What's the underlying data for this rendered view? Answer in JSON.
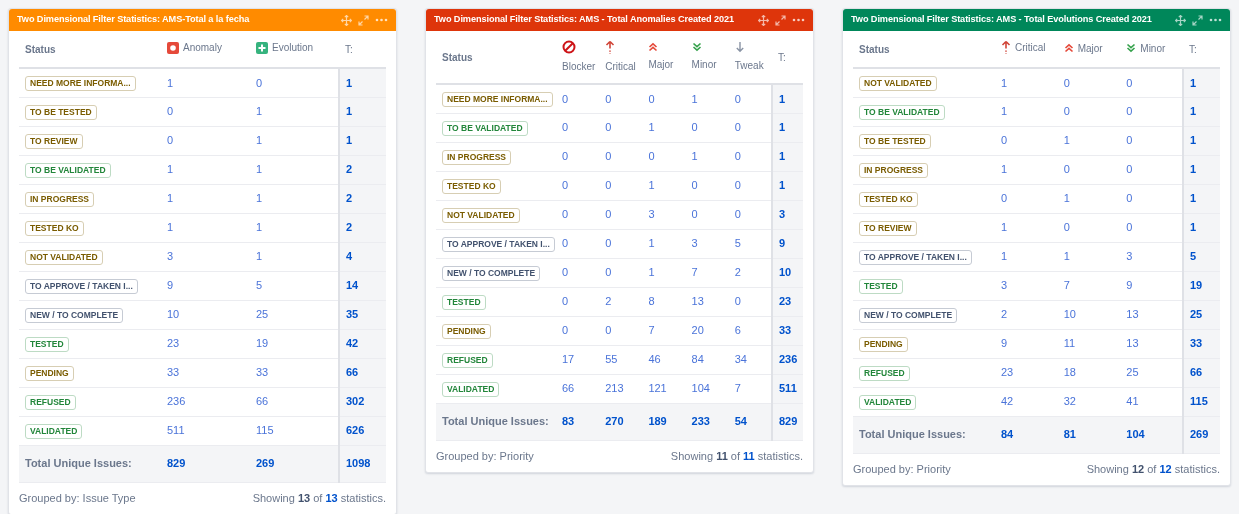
{
  "gadgets": [
    {
      "title": "Two Dimensional Filter Statistics: AMS-Total a la fecha",
      "color": "#ff8b00",
      "stacked": false,
      "status_label": "Status",
      "total_label": "T:",
      "columns": [
        {
          "label": "Anomaly",
          "kind": "anomaly"
        },
        {
          "label": "Evolution",
          "kind": "evolution"
        }
      ],
      "rows": [
        {
          "status": "NEED MORE INFORMA...",
          "color": "#7a5c00",
          "values": [
            "1",
            "0"
          ],
          "total": "1"
        },
        {
          "status": "TO BE TESTED",
          "color": "#7a5c00",
          "values": [
            "0",
            "1"
          ],
          "total": "1"
        },
        {
          "status": "TO REVIEW",
          "color": "#7a5c00",
          "values": [
            "0",
            "1"
          ],
          "total": "1"
        },
        {
          "status": "TO BE VALIDATED",
          "color": "#22863a",
          "values": [
            "1",
            "1"
          ],
          "total": "2"
        },
        {
          "status": "IN PROGRESS",
          "color": "#7a5c00",
          "values": [
            "1",
            "1"
          ],
          "total": "2"
        },
        {
          "status": "TESTED KO",
          "color": "#7a5c00",
          "values": [
            "1",
            "1"
          ],
          "total": "2"
        },
        {
          "status": "NOT VALIDATED",
          "color": "#7a5c00",
          "values": [
            "3",
            "1"
          ],
          "total": "4"
        },
        {
          "status": "TO APPROVE / TAKEN I...",
          "color": "#42526e",
          "values": [
            "9",
            "5"
          ],
          "total": "14"
        },
        {
          "status": "NEW / TO COMPLETE",
          "color": "#42526e",
          "values": [
            "10",
            "25"
          ],
          "total": "35"
        },
        {
          "status": "TESTED",
          "color": "#22863a",
          "values": [
            "23",
            "19"
          ],
          "total": "42"
        },
        {
          "status": "PENDING",
          "color": "#7a5c00",
          "values": [
            "33",
            "33"
          ],
          "total": "66"
        },
        {
          "status": "REFUSED",
          "color": "#22863a",
          "values": [
            "236",
            "66"
          ],
          "total": "302"
        },
        {
          "status": "VALIDATED",
          "color": "#22863a",
          "values": [
            "511",
            "115"
          ],
          "total": "626"
        }
      ],
      "totals": {
        "label": "Total Unique Issues:",
        "values": [
          "829",
          "269"
        ],
        "total": "1098"
      },
      "footer": {
        "grouped_by": "Grouped by: Issue Type",
        "showing": "Showing",
        "shown": "13",
        "of": "of",
        "count": "13",
        "suffix": "statistics."
      }
    },
    {
      "title": "Two Dimensional Filter Statistics: AMS - Total Anomalies Created 2021",
      "color": "#de350b",
      "stacked": true,
      "status_label": "Status",
      "total_label": "T:",
      "columns": [
        {
          "label": "Blocker",
          "kind": "blocker"
        },
        {
          "label": "Critical",
          "kind": "critical"
        },
        {
          "label": "Major",
          "kind": "major"
        },
        {
          "label": "Minor",
          "kind": "minor"
        },
        {
          "label": "Tweak",
          "kind": "tweak"
        }
      ],
      "rows": [
        {
          "status": "NEED MORE INFORMA...",
          "color": "#7a5c00",
          "values": [
            "0",
            "0",
            "0",
            "1",
            "0"
          ],
          "total": "1"
        },
        {
          "status": "TO BE VALIDATED",
          "color": "#22863a",
          "values": [
            "0",
            "0",
            "1",
            "0",
            "0"
          ],
          "total": "1"
        },
        {
          "status": "IN PROGRESS",
          "color": "#7a5c00",
          "values": [
            "0",
            "0",
            "0",
            "1",
            "0"
          ],
          "total": "1"
        },
        {
          "status": "TESTED KO",
          "color": "#7a5c00",
          "values": [
            "0",
            "0",
            "1",
            "0",
            "0"
          ],
          "total": "1"
        },
        {
          "status": "NOT VALIDATED",
          "color": "#7a5c00",
          "values": [
            "0",
            "0",
            "3",
            "0",
            "0"
          ],
          "total": "3"
        },
        {
          "status": "TO APPROVE / TAKEN I...",
          "color": "#42526e",
          "values": [
            "0",
            "0",
            "1",
            "3",
            "5"
          ],
          "total": "9"
        },
        {
          "status": "NEW / TO COMPLETE",
          "color": "#42526e",
          "values": [
            "0",
            "0",
            "1",
            "7",
            "2"
          ],
          "total": "10"
        },
        {
          "status": "TESTED",
          "color": "#22863a",
          "values": [
            "0",
            "2",
            "8",
            "13",
            "0"
          ],
          "total": "23"
        },
        {
          "status": "PENDING",
          "color": "#7a5c00",
          "values": [
            "0",
            "0",
            "7",
            "20",
            "6"
          ],
          "total": "33"
        },
        {
          "status": "REFUSED",
          "color": "#22863a",
          "values": [
            "17",
            "55",
            "46",
            "84",
            "34"
          ],
          "total": "236"
        },
        {
          "status": "VALIDATED",
          "color": "#22863a",
          "values": [
            "66",
            "213",
            "121",
            "104",
            "7"
          ],
          "total": "511"
        }
      ],
      "totals": {
        "label": "Total Unique Issues:",
        "values": [
          "83",
          "270",
          "189",
          "233",
          "54"
        ],
        "total": "829"
      },
      "footer": {
        "grouped_by": "Grouped by: Priority",
        "showing": "Showing",
        "shown": "11",
        "of": "of",
        "count": "11",
        "suffix": "statistics."
      }
    },
    {
      "title": "Two Dimensional Filter Statistics: AMS - Total Evolutions Created 2021",
      "color": "#00875a",
      "stacked": false,
      "status_label": "Status",
      "total_label": "T:",
      "columns": [
        {
          "label": "Critical",
          "kind": "critical"
        },
        {
          "label": "Major",
          "kind": "major"
        },
        {
          "label": "Minor",
          "kind": "minor"
        }
      ],
      "rows": [
        {
          "status": "NOT VALIDATED",
          "color": "#7a5c00",
          "values": [
            "1",
            "0",
            "0"
          ],
          "total": "1"
        },
        {
          "status": "TO BE VALIDATED",
          "color": "#22863a",
          "values": [
            "1",
            "0",
            "0"
          ],
          "total": "1"
        },
        {
          "status": "TO BE TESTED",
          "color": "#7a5c00",
          "values": [
            "0",
            "1",
            "0"
          ],
          "total": "1"
        },
        {
          "status": "IN PROGRESS",
          "color": "#7a5c00",
          "values": [
            "1",
            "0",
            "0"
          ],
          "total": "1"
        },
        {
          "status": "TESTED KO",
          "color": "#7a5c00",
          "values": [
            "0",
            "1",
            "0"
          ],
          "total": "1"
        },
        {
          "status": "TO REVIEW",
          "color": "#7a5c00",
          "values": [
            "1",
            "0",
            "0"
          ],
          "total": "1"
        },
        {
          "status": "TO APPROVE / TAKEN I...",
          "color": "#42526e",
          "values": [
            "1",
            "1",
            "3"
          ],
          "total": "5"
        },
        {
          "status": "TESTED",
          "color": "#22863a",
          "values": [
            "3",
            "7",
            "9"
          ],
          "total": "19"
        },
        {
          "status": "NEW / TO COMPLETE",
          "color": "#42526e",
          "values": [
            "2",
            "10",
            "13"
          ],
          "total": "25"
        },
        {
          "status": "PENDING",
          "color": "#7a5c00",
          "values": [
            "9",
            "11",
            "13"
          ],
          "total": "33"
        },
        {
          "status": "REFUSED",
          "color": "#22863a",
          "values": [
            "23",
            "18",
            "25"
          ],
          "total": "66"
        },
        {
          "status": "VALIDATED",
          "color": "#22863a",
          "values": [
            "42",
            "32",
            "41"
          ],
          "total": "115"
        }
      ],
      "totals": {
        "label": "Total Unique Issues:",
        "values": [
          "84",
          "81",
          "104"
        ],
        "total": "269"
      },
      "footer": {
        "grouped_by": "Grouped by: Priority",
        "showing": "Showing",
        "shown": "12",
        "of": "of",
        "count": "12",
        "suffix": "statistics."
      }
    }
  ]
}
